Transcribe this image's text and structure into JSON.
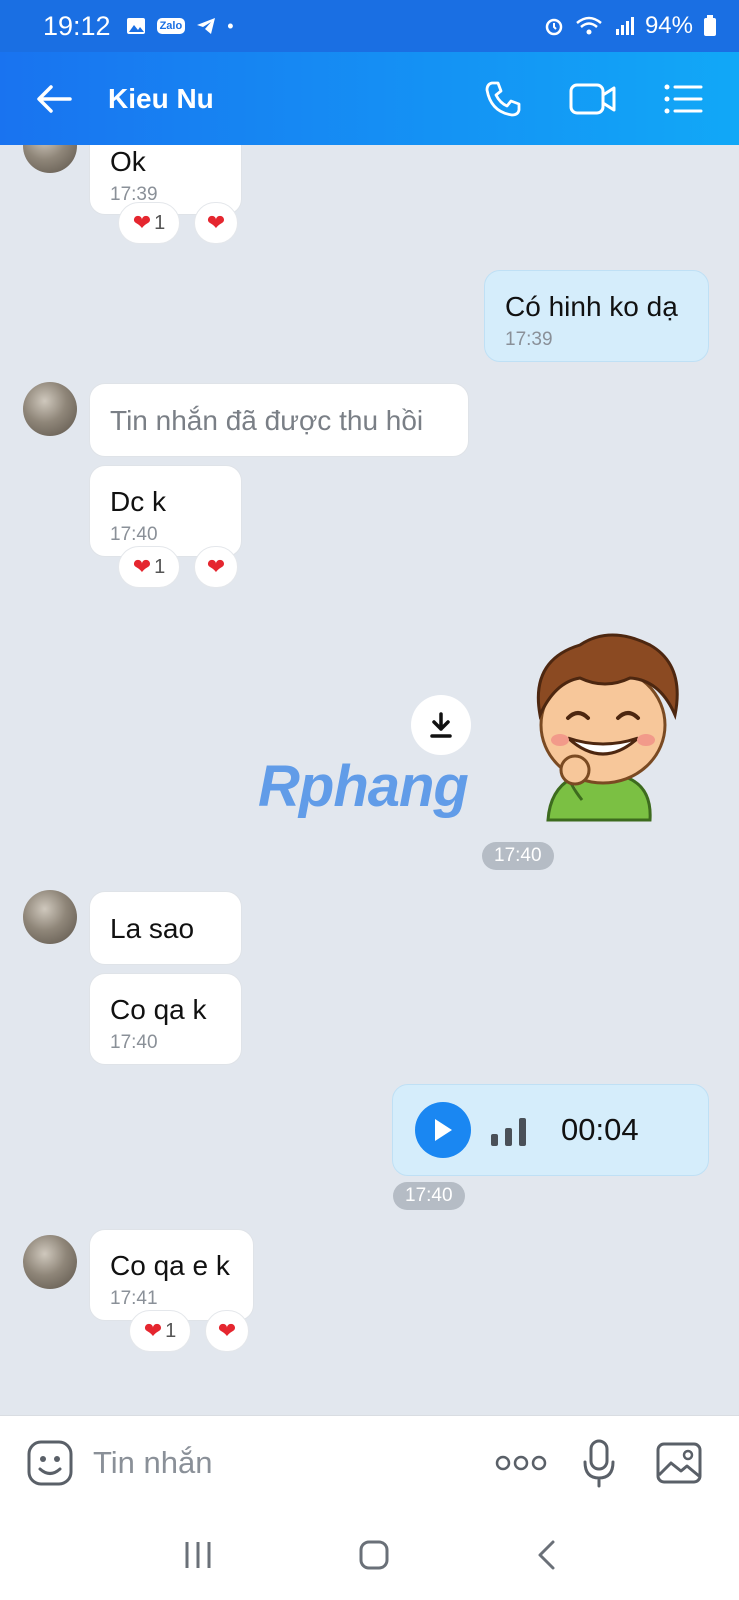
{
  "status": {
    "time": "19:12",
    "zalo_badge": "Zalo",
    "battery": "94%"
  },
  "header": {
    "contact_name": "Kieu Nu"
  },
  "messages": {
    "m1": {
      "text": "Ok",
      "time": "17:39",
      "reaction_count": "1"
    },
    "m2": {
      "text": "Có hinh ko dạ",
      "time": "17:39"
    },
    "m3": {
      "text": "Tin nhắn đã được thu hồi"
    },
    "m4": {
      "text": "Dc k",
      "time": "17:40",
      "reaction_count": "1"
    },
    "sticker": {
      "watermark": "Rphang",
      "time": "17:40"
    },
    "m5": {
      "text": "La sao"
    },
    "m6": {
      "text": "Co qa k",
      "time": "17:40"
    },
    "voice": {
      "duration": "00:04",
      "time": "17:40"
    },
    "m7": {
      "text": "Co qa e k",
      "time": "17:41",
      "reaction_count": "1"
    }
  },
  "composer": {
    "placeholder": "Tin nhắn"
  },
  "colors": {
    "header_start": "#1973f0",
    "header_end": "#11a8f7",
    "outgoing_bubble": "#d5edfb",
    "chat_bg": "#e2e7ee",
    "heart": "#e5262f"
  }
}
